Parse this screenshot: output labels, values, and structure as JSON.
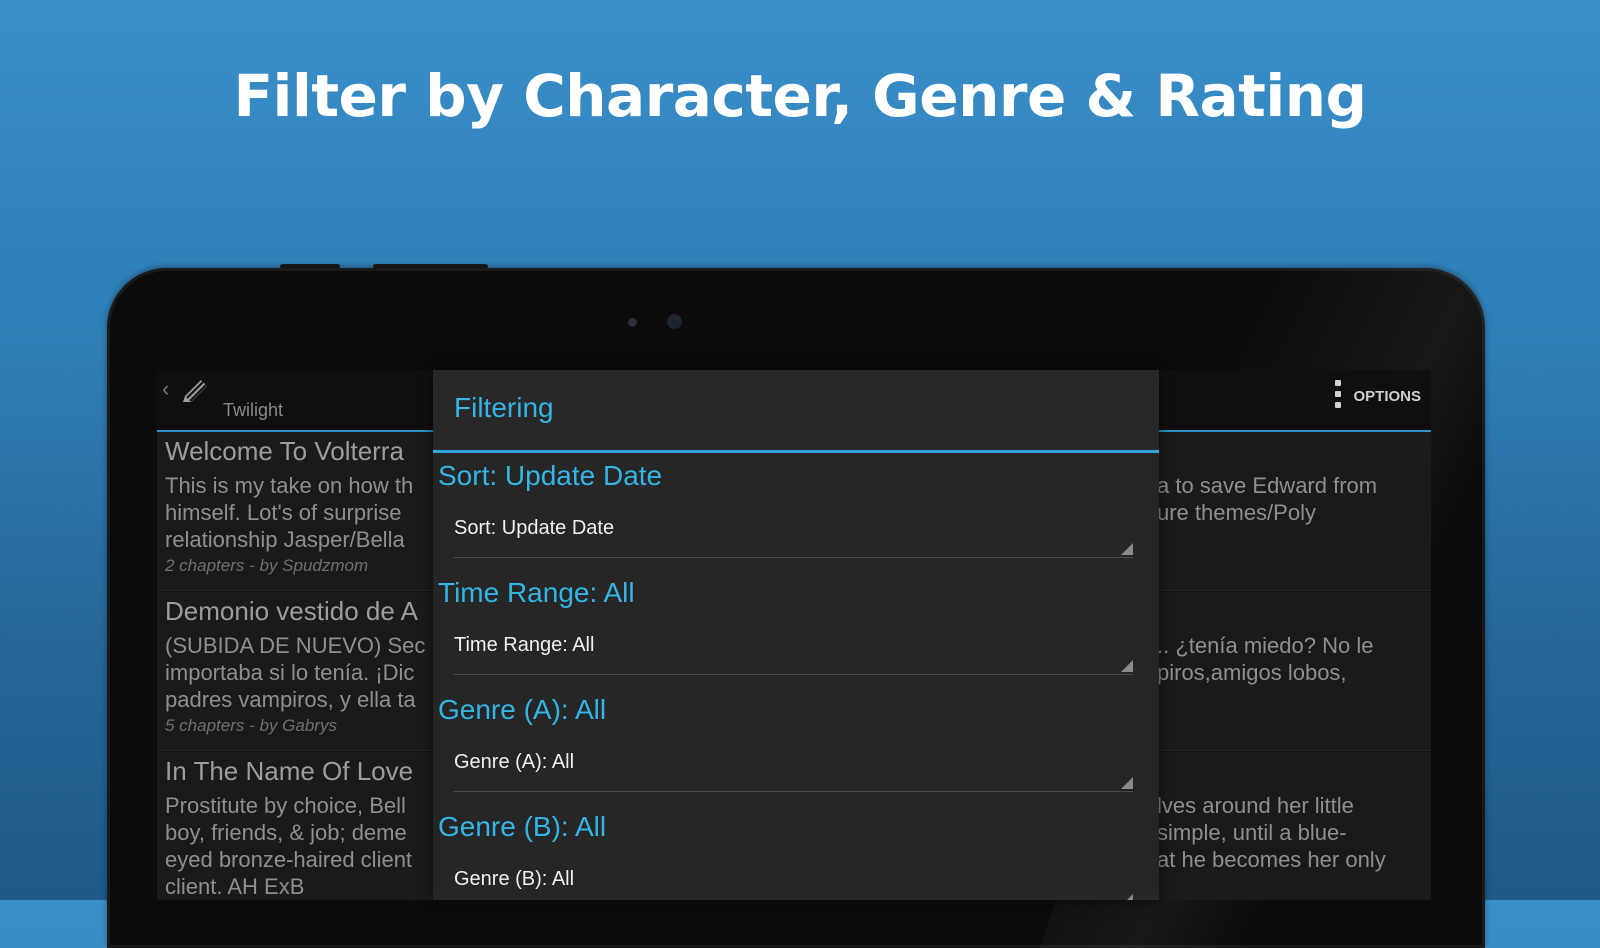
{
  "headline": "Filter by Character, Genre & Rating",
  "action_bar": {
    "title": "Twilight",
    "options_label": "OPTIONS"
  },
  "stories": [
    {
      "title": "Welcome To Volterra",
      "left_desc": [
        "This is my take on how th",
        "himself. Lot's of surprise",
        "relationship Jasper/Bella"
      ],
      "right_desc": [
        "a to save Edward from",
        "ure themes/Poly",
        ""
      ],
      "meta": "2 chapters - by Spudzmom"
    },
    {
      "title": "Demonio vestido de A",
      "left_desc": [
        "(SUBIDA DE NUEVO) Sec",
        "importaba si lo tenía. ¡Dic",
        "padres vampiros, y ella ta"
      ],
      "right_desc": [
        ".. ¿tenía miedo? No le",
        "piros,amigos lobos,",
        ""
      ],
      "meta": "5 chapters - by Gabrys"
    },
    {
      "title": "In The Name Of Love",
      "left_desc": [
        "Prostitute by choice, Bell",
        "boy, friends, & job; deme",
        "eyed bronze-haired client",
        "client. AH ExB"
      ],
      "right_desc": [
        "lves around her little",
        " simple, until a blue-",
        "at he becomes her only"
      ],
      "meta": ""
    }
  ],
  "dialog": {
    "title": "Filtering",
    "groups": [
      {
        "label": "Sort: Update Date",
        "value": "Sort: Update Date"
      },
      {
        "label": "Time Range: All",
        "value": "Time Range: All"
      },
      {
        "label": "Genre (A): All",
        "value": "Genre (A): All"
      },
      {
        "label": "Genre (B): All",
        "value": "Genre (B): All"
      }
    ]
  },
  "colors": {
    "accent": "#33b5e5",
    "background_top": "#3a8fc8",
    "background_bottom": "#1f5a88",
    "dialog_bg": "#262626"
  }
}
